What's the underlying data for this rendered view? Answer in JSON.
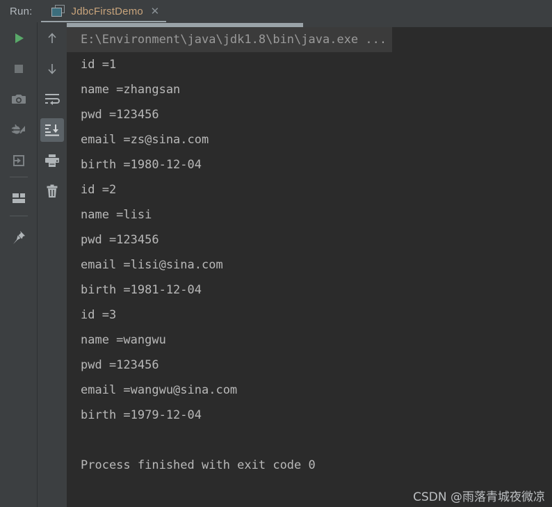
{
  "window": {
    "run_label": "Run:",
    "background_color": "#2b2b2b",
    "toolbar_color": "#3c3f41"
  },
  "tab": {
    "title": "JdbcFirstDemo",
    "close_glyph": "✕",
    "icon_name": "application-window-icon",
    "active": true,
    "title_color": "#c8a47c"
  },
  "left_toolbar": {
    "items": [
      {
        "name": "rerun-button",
        "icon": "play-triangle-icon",
        "selected": false
      },
      {
        "name": "stop-button",
        "icon": "stop-square-icon",
        "selected": false
      },
      {
        "name": "screenshot-button",
        "icon": "camera-icon",
        "selected": false
      },
      {
        "name": "dump-threads-button",
        "icon": "bug-arrow-icon",
        "selected": false
      },
      {
        "name": "restore-layout-button",
        "icon": "enter-arrow-box-icon",
        "selected": false
      },
      {
        "name": "layout-settings-button",
        "icon": "layout-panels-icon",
        "selected": false
      },
      {
        "name": "pin-tab-button",
        "icon": "pin-icon",
        "selected": false
      }
    ]
  },
  "right_toolbar": {
    "items": [
      {
        "name": "up-the-stack-button",
        "icon": "arrow-up-icon",
        "selected": false
      },
      {
        "name": "down-the-stack-button",
        "icon": "arrow-down-icon",
        "selected": false
      },
      {
        "name": "soft-wrap-button",
        "icon": "soft-wrap-icon",
        "selected": false
      },
      {
        "name": "scroll-to-end-button",
        "icon": "scroll-to-end-icon",
        "selected": true
      },
      {
        "name": "print-button",
        "icon": "printer-icon",
        "selected": false
      },
      {
        "name": "clear-all-button",
        "icon": "trash-icon",
        "selected": false
      }
    ]
  },
  "console": {
    "command_line": "E:\\Environment\\java\\jdk1.8\\bin\\java.exe ...",
    "output_lines": [
      "id =1",
      "name =zhangsan",
      "pwd =123456",
      "email =zs@sina.com",
      "birth =1980-12-04",
      "id =2",
      "name =lisi",
      "pwd =123456",
      "email =lisi@sina.com",
      "birth =1981-12-04",
      "id =3",
      "name =wangwu",
      "pwd =123456",
      "email =wangwu@sina.com",
      "birth =1979-12-04",
      "",
      "Process finished with exit code 0"
    ]
  },
  "watermark": {
    "text": "CSDN @雨落青城夜微凉"
  }
}
